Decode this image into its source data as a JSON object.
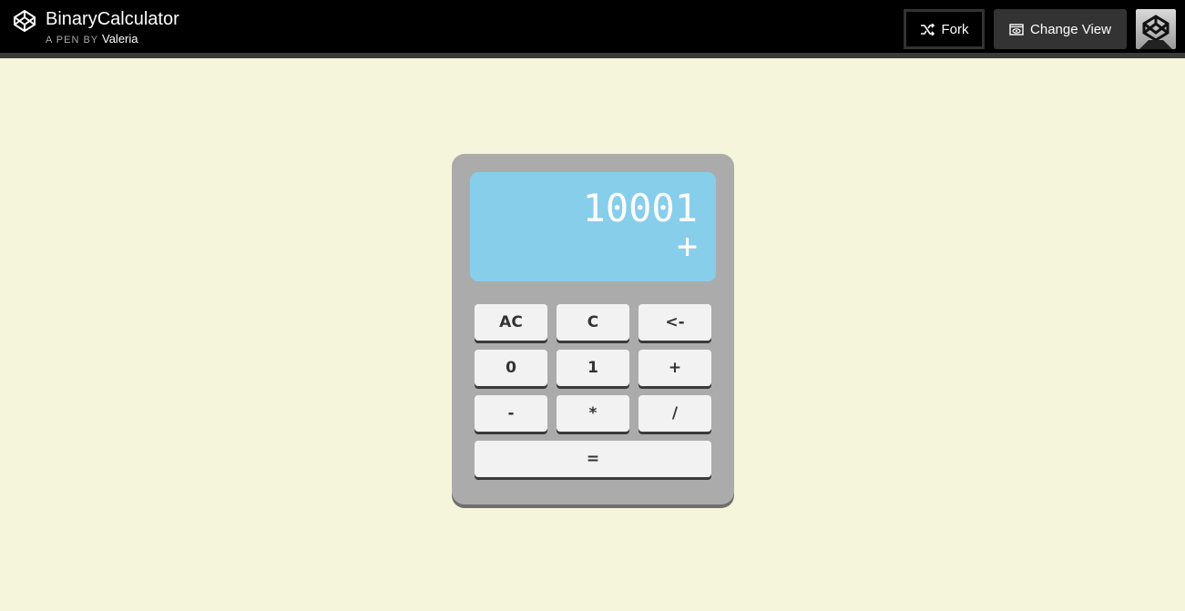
{
  "header": {
    "title": "BinaryCalculator",
    "byline_prefix": "A PEN BY",
    "author": "Valeria",
    "fork_label": "Fork",
    "change_view_label": "Change View"
  },
  "calculator": {
    "display_value": "10001",
    "display_operator": "+",
    "keys": {
      "ac": "AC",
      "c": "C",
      "back": "<-",
      "zero": "0",
      "one": "1",
      "plus": "+",
      "minus": "-",
      "times": "*",
      "divide": "/",
      "equals": "="
    }
  },
  "colors": {
    "page_bg": "#f5f5dc",
    "calc_body": "#ababab",
    "screen": "#87ceeb",
    "key_face": "#f2f2f2"
  }
}
